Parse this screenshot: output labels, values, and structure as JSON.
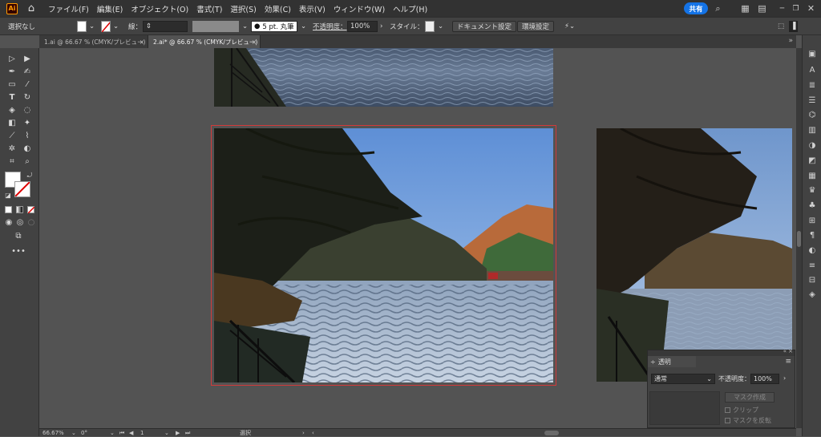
{
  "app": {
    "logo_text": "Ai"
  },
  "menubar": {
    "items": [
      "ファイル(F)",
      "編集(E)",
      "オブジェクト(O)",
      "書式(T)",
      "選択(S)",
      "効果(C)",
      "表示(V)",
      "ウィンドウ(W)",
      "ヘルプ(H)"
    ],
    "share_label": "共有"
  },
  "control": {
    "selection": "選択なし",
    "stroke_label": "線：",
    "brush_label": "5 pt. 丸筆",
    "opacity_label": "不透明度：",
    "opacity_value": "100%",
    "style_label": "スタイル：",
    "doc_setup": "ドキュメント設定",
    "prefs": "環境設定"
  },
  "tabs": [
    {
      "label": "1.ai @ 66.67 % (CMYK/プレビュー)",
      "close": "×"
    },
    {
      "label": "2.ai* @ 66.67 % (CMYK/プレビュー)",
      "close": "×"
    }
  ],
  "status": {
    "zoom": "66.67%",
    "rotation": "0°",
    "artboard": "1",
    "mode": "選択"
  },
  "transparency": {
    "title": "透明",
    "blend_mode": "通常",
    "opacity_label": "不透明度：",
    "opacity_value": "100%",
    "make_mask": "マスク作成",
    "clip": "クリップ",
    "invert": "マスクを反転"
  },
  "colors": {
    "artboard_selection": "#d23a3a",
    "share_button": "#1473e6"
  }
}
